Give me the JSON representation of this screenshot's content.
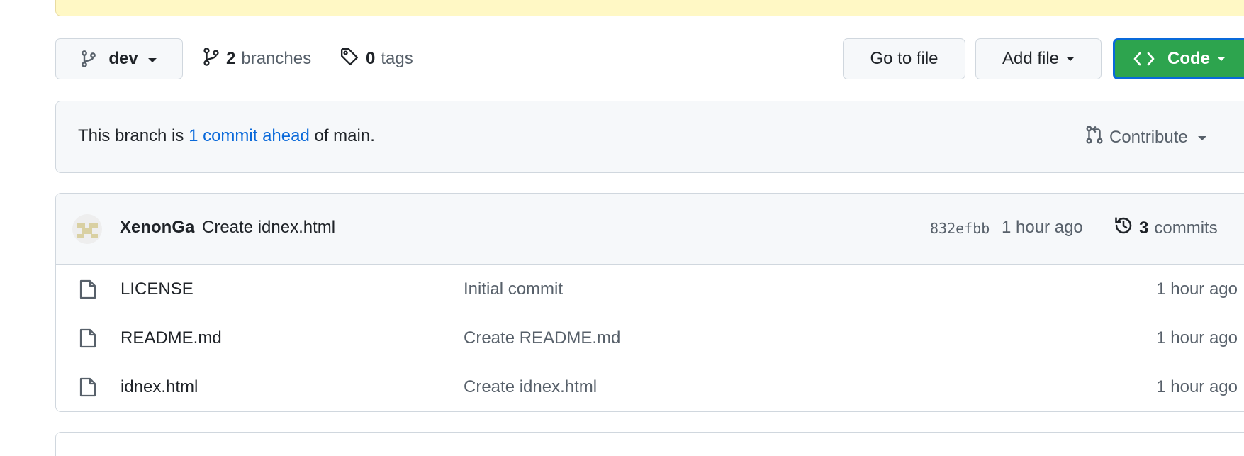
{
  "toolbar": {
    "branch": "dev",
    "branches_count": "2",
    "branches_label": "branches",
    "tags_count": "0",
    "tags_label": "tags",
    "goto_file": "Go to file",
    "add_file": "Add file",
    "code": "Code"
  },
  "branch_status": {
    "prefix": "This branch is",
    "ahead_link": "1 commit ahead",
    "suffix": "of main.",
    "contribute": "Contribute"
  },
  "latest_commit": {
    "author": "XenonGa",
    "message": "Create idnex.html",
    "sha": "832efbb",
    "time": "1 hour ago",
    "commits_count": "3",
    "commits_label": "commits"
  },
  "files": [
    {
      "icon": "file-icon",
      "name": "LICENSE",
      "message": "Initial commit",
      "time": "1 hour ago"
    },
    {
      "icon": "file-icon",
      "name": "README.md",
      "message": "Create README.md",
      "time": "1 hour ago"
    },
    {
      "icon": "file-icon",
      "name": "idnex.html",
      "message": "Create idnex.html",
      "time": "1 hour ago"
    }
  ],
  "colors": {
    "primary_button": "#2da44e",
    "focus_ring": "#0969da",
    "link": "#0969da",
    "banner": "#fff8c5"
  }
}
